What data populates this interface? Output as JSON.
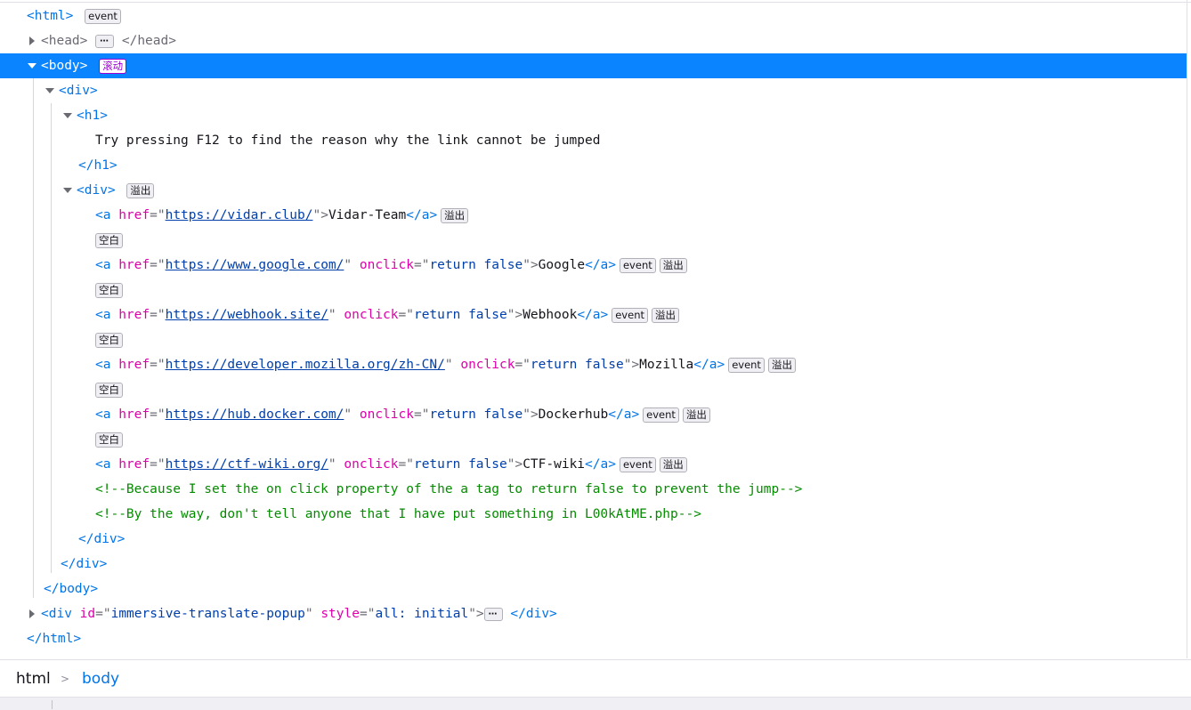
{
  "tree": {
    "html_open": "<html>",
    "event_badge": "event",
    "ellipsis_badge": "⋯",
    "head_open": "<head>",
    "head_close": "</head>",
    "body_open": "<body>",
    "scroll_badge": "滚动",
    "div_open": "<div>",
    "h1_open": "<h1>",
    "h1_text": "Try pressing F12 to find the reason why the link cannot be jumped",
    "h1_close": "</h1>",
    "overflow_badge": "溢出",
    "whitespace_badge": "空白",
    "a_open_prefix": "<a",
    "href_attr": "href",
    "onclick_attr": "onclick",
    "onclick_value": "return false",
    "a_close": "</a>",
    "links": [
      {
        "href": "https://vidar.club/",
        "text": "Vidar-Team",
        "onclick": false
      },
      {
        "href": "https://www.google.com/",
        "text": "Google",
        "onclick": true
      },
      {
        "href": "https://webhook.site/",
        "text": "Webhook",
        "onclick": true
      },
      {
        "href": "https://developer.mozilla.org/zh-CN/",
        "text": "Mozilla",
        "onclick": true
      },
      {
        "href": "https://hub.docker.com/",
        "text": "Dockerhub",
        "onclick": true
      },
      {
        "href": "https://ctf-wiki.org/",
        "text": "CTF-wiki",
        "onclick": true
      }
    ],
    "comment_1": "<!--Because I set the on click property of the a tag to return false to prevent the jump-->",
    "comment_2": "<!--By the way, don't tell anyone that I have put something in L00kAtME.php-->",
    "div_close": "</div>",
    "body_close": "</body>",
    "popup_div_prefix": "<div",
    "popup_id_attr": "id",
    "popup_id_value": "immersive-translate-popup",
    "popup_style_attr": "style",
    "popup_style_value": "all: initial",
    "html_close": "</html>"
  },
  "breadcrumb": {
    "items": [
      "html",
      "body"
    ],
    "separator": ">"
  },
  "colors": {
    "selection": "#0a84ff",
    "tag": "#0074e8",
    "attribute_name": "#dd00a9",
    "comment": "#058b00",
    "scroll_badge": "#9d00d4"
  }
}
